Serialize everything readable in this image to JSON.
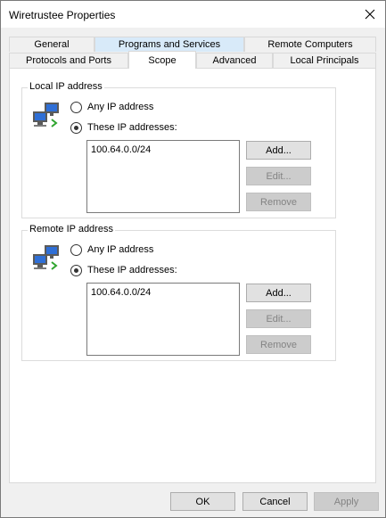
{
  "window": {
    "title": "Wiretrustee Properties"
  },
  "tabs": {
    "row1": [
      {
        "label": "General"
      },
      {
        "label": "Programs and Services"
      },
      {
        "label": "Remote Computers"
      }
    ],
    "row2": [
      {
        "label": "Protocols and Ports"
      },
      {
        "label": "Scope"
      },
      {
        "label": "Advanced"
      },
      {
        "label": "Local Principals"
      }
    ],
    "selected": "Scope"
  },
  "local": {
    "group_label": "Local IP address",
    "any_label": "Any IP address",
    "these_label": "These IP addresses:",
    "selected_option": "these",
    "addresses": [
      "100.64.0.0/24"
    ],
    "add_label": "Add...",
    "edit_label": "Edit...",
    "remove_label": "Remove"
  },
  "remote": {
    "group_label": "Remote IP address",
    "any_label": "Any IP address",
    "these_label": "These IP addresses:",
    "selected_option": "these",
    "addresses": [
      "100.64.0.0/24"
    ],
    "add_label": "Add...",
    "edit_label": "Edit...",
    "remove_label": "Remove"
  },
  "footer": {
    "ok_label": "OK",
    "cancel_label": "Cancel",
    "apply_label": "Apply"
  },
  "icons": {
    "close": "close-icon",
    "network": "network-computers-icon"
  },
  "colors": {
    "accent": "#0078d7",
    "tab_highlight": "#d8eaf9",
    "disabled_text": "#838383"
  }
}
